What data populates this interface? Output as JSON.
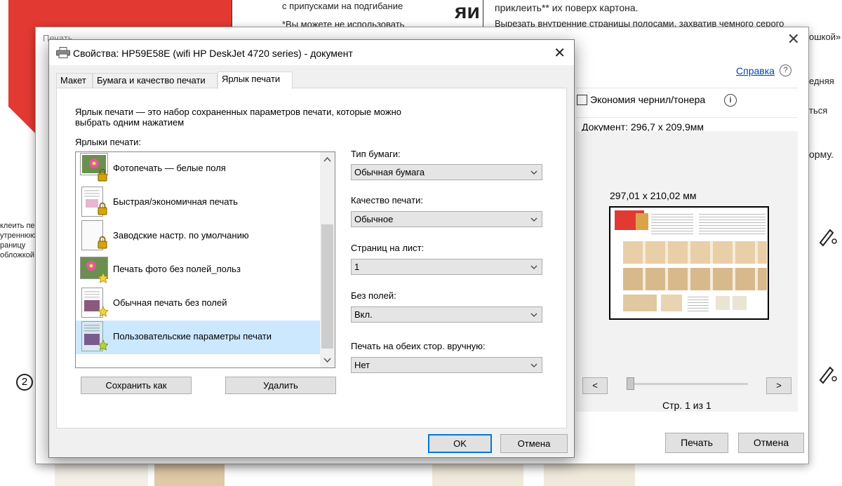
{
  "background": {
    "top_texts": [
      "с припусками на подгибание",
      "*Вы можете не использовать"
    ],
    "vertical_text": "яи",
    "right_texts": [
      "приклеить** их поверх картона.",
      "Вырезать внутренние страницы полосами, захватив чемного серого",
      "ошкой»",
      "едняя",
      "ться",
      "орму."
    ],
    "left_texts": [
      "клеить пер",
      "утреннюю",
      "раницу",
      "обложкой"
    ],
    "circle_number": "2"
  },
  "outer_dialog": {
    "title": "Печать",
    "close_glyph": "✕",
    "help_link": "Справка",
    "help_icon_glyph": "?",
    "eco_label": "Экономия чернил/тонера",
    "eco_checked": false,
    "info_icon_glyph": "i",
    "doc_size": "Документ: 296,7 x 209,9мм",
    "paper_size": "297,01 x 210,02 мм",
    "prev_label": "<",
    "next_label": ">",
    "page_indicator": "Стр. 1 из 1",
    "print_button": "Печать",
    "cancel_button": "Отмена"
  },
  "props_dialog": {
    "title": "Свойства: HP59E58E (wifi HP DeskJet 4720 series) - документ",
    "close_glyph": "✕",
    "tabs": [
      {
        "label": "Макет",
        "active": false
      },
      {
        "label": "Бумага и качество печати",
        "active": false
      },
      {
        "label": "Ярлык печати",
        "active": true
      }
    ],
    "description": "Ярлык печати — это набор сохраненных параметров печати, которые можно выбрать одним нажатием",
    "list_label": "Ярлыки печати:",
    "shortcuts": [
      {
        "label": "Фотопечать — белые поля",
        "badge": "lock",
        "thumb": "photo",
        "selected": false
      },
      {
        "label": "Быстрая/экономичная печать",
        "badge": "lock",
        "thumb": "doc-photo",
        "selected": false
      },
      {
        "label": "Заводские настр. по умолчанию",
        "badge": "lock",
        "thumb": "blank",
        "selected": false
      },
      {
        "label": "Печать фото без полей_польз",
        "badge": "star",
        "thumb": "photo",
        "selected": false
      },
      {
        "label": "Обычная печать без полей",
        "badge": "star",
        "thumb": "doc-photo",
        "selected": false
      },
      {
        "label": "Пользовательские параметры печати",
        "badge": "star",
        "thumb": "doc-blue",
        "selected": true
      }
    ],
    "save_as_button": "Сохранить как",
    "delete_button": "Удалить",
    "fields": [
      {
        "label": "Тип бумаги:",
        "value": "Обычная бумага"
      },
      {
        "label": "Качество печати:",
        "value": "Обычное"
      },
      {
        "label": "Страниц на лист:",
        "value": "1"
      },
      {
        "label": "Без полей:",
        "value": "Вкл."
      },
      {
        "label": "Печать на обеих стор. вручную:",
        "value": "Нет"
      }
    ],
    "ok_button": "OK",
    "cancel_button": "Отмена"
  },
  "colors": {
    "selection": "#cce8ff",
    "accent": "#0078d7",
    "link": "#0645ad",
    "doc_red": "#e23a33"
  }
}
